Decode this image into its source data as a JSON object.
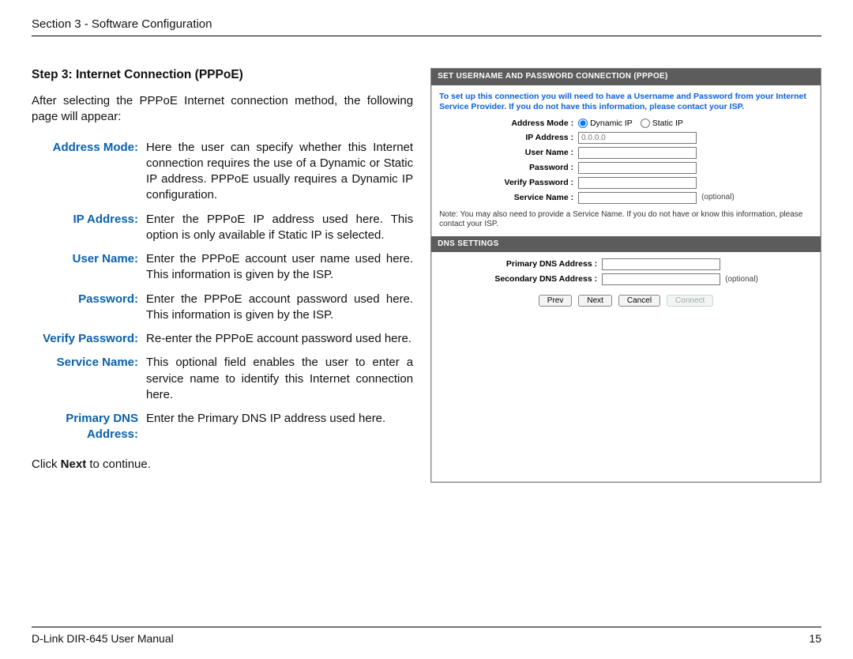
{
  "header": {
    "section": "Section 3 - Software Configuration"
  },
  "title": "Step 3: Internet Connection (PPPoE)",
  "intro": "After selecting the PPPoE Internet connection method, the following page will appear:",
  "defs": [
    {
      "label": "Address Mode:",
      "text": "Here the user can specify whether this Internet connection requires the use of a Dynamic or Static IP address. PPPoE usually requires a Dynamic IP configuration."
    },
    {
      "label": "IP Address:",
      "text": "Enter the PPPoE IP address used here. This option is only available if Static IP is selected."
    },
    {
      "label": "User Name:",
      "text": "Enter the PPPoE account user name used here. This information is given by the ISP."
    },
    {
      "label": "Password:",
      "text": "Enter the PPPoE account password used here. This information is given by the ISP."
    },
    {
      "label": "Verify Password:",
      "text": "Re-enter the PPPoE account password used here."
    },
    {
      "label": "Service Name:",
      "text": "This optional field enables the user to enter a service name to identify this Internet connection here."
    },
    {
      "label": "Primary DNS Address:",
      "text": "Enter the Primary DNS IP address used here."
    }
  ],
  "outro_pre": "Click ",
  "outro_bold": "Next",
  "outro_post": " to continue.",
  "shot": {
    "bar1": "SET USERNAME AND PASSWORD CONNECTION (PPPOE)",
    "msg": "To set up this connection you will need to have a Username and Password from your Internet Service Provider. If you do not have this information, please contact your ISP.",
    "labels": {
      "addrmode": "Address Mode  :",
      "ip": "IP Address  :",
      "user": "User Name  :",
      "pass": "Password  :",
      "vpass": "Verify Password  :",
      "svc": "Service Name  :",
      "pdns": "Primary DNS Address  :",
      "sdns": "Secondary DNS Address  :"
    },
    "radio_dyn": "Dynamic IP",
    "radio_stat": "Static IP",
    "ip_placeholder": "0.0.0.0",
    "optional": "(optional)",
    "note": "Note: You may also need to provide a Service Name. If you do not have or know this information, please contact your ISP.",
    "bar2": "DNS SETTINGS",
    "btn_prev": "Prev",
    "btn_next": "Next",
    "btn_cancel": "Cancel",
    "btn_connect": "Connect"
  },
  "footer": {
    "left": "D-Link DIR-645 User Manual",
    "right": "15"
  }
}
